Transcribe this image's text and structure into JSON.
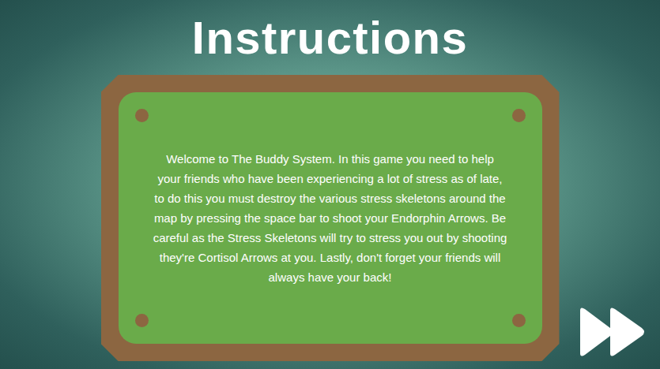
{
  "title": "Instructions",
  "panel": {
    "text": "Welcome to The Buddy System. In this game you need to help your friends who have been experiencing a lot of stress as of late, to do this you must destroy the various stress skeletons around the map by pressing the space bar to shoot your Endorphin Arrows. Be careful as the Stress Skeletons will try to stress you out by shooting they're Cortisol Arrows at you. Lastly, don't forget your friends will always have your back!"
  }
}
